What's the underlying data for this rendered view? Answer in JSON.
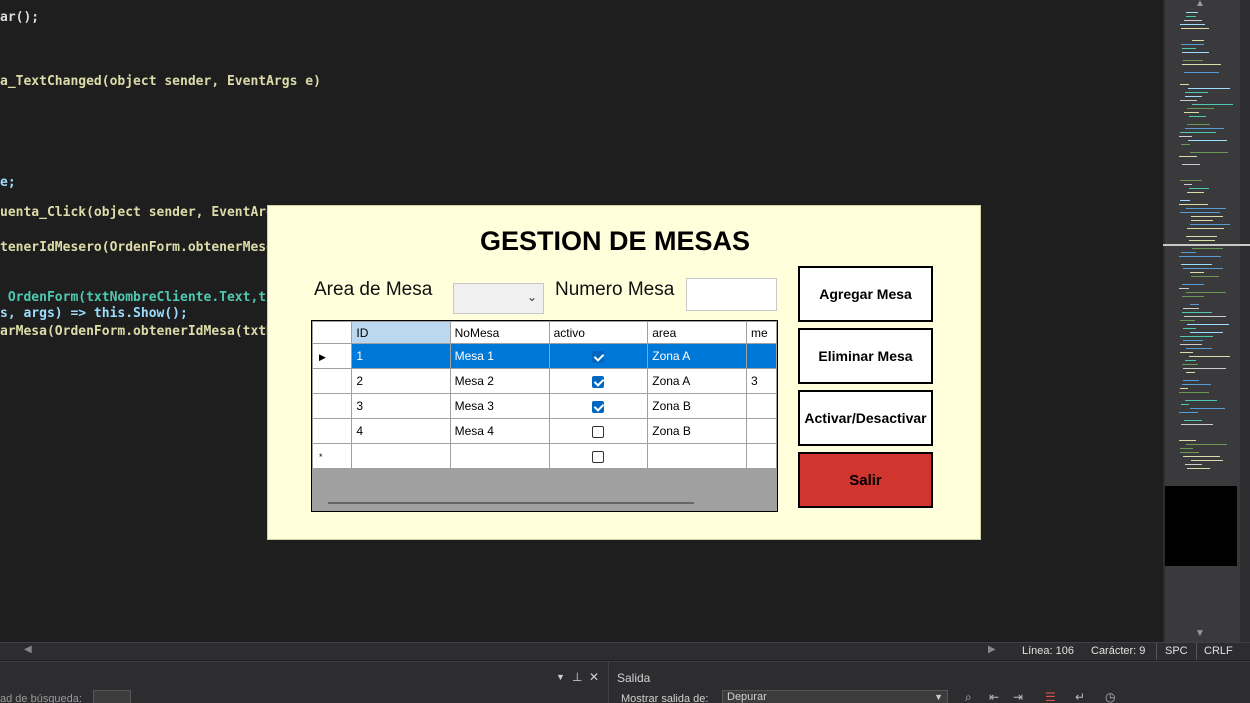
{
  "editor": {
    "lines": [
      "ar();",
      "a_TextChanged(object sender, EventArgs e)",
      "e;",
      "uenta_Click(object sender, EventArgs",
      "tenerIdMesero(OrdenForm.obtenerMesero",
      " OrdenForm(txtNombreCliente.Text,txt",
      "s, args) => this.Show();",
      "arMesa(OrdenForm.obtenerIdMesa(txtNo"
    ]
  },
  "dialog": {
    "title": "GESTION DE MESAS",
    "area_label": "Area de Mesa",
    "numero_label": "Numero Mesa",
    "area_value": "",
    "numero_value": "",
    "buttons": {
      "agregar": "Agregar Mesa",
      "eliminar": "Eliminar Mesa",
      "activar": "Activar/Desactivar",
      "salir": "Salir"
    },
    "grid": {
      "columns": [
        "ID",
        "NoMesa",
        "activo",
        "area",
        "me"
      ],
      "rows": [
        {
          "id": "1",
          "nomesa": "Mesa 1",
          "activo": true,
          "area": "Zona A",
          "extra": ""
        },
        {
          "id": "2",
          "nomesa": "Mesa 2",
          "activo": true,
          "area": "Zona A",
          "extra": "3"
        },
        {
          "id": "3",
          "nomesa": "Mesa 3",
          "activo": true,
          "area": "Zona B",
          "extra": ""
        },
        {
          "id": "4",
          "nomesa": "Mesa 4",
          "activo": false,
          "area": "Zona B",
          "extra": ""
        }
      ],
      "new_row_marker": "*",
      "current_row_marker": "▶"
    }
  },
  "statusbar": {
    "linea": "Línea: 106",
    "caracter": "Carácter: 9",
    "spc": "SPC",
    "crlf": "CRLF"
  },
  "bottom": {
    "busqueda": "ad de búsqueda:",
    "salida_title": "Salida",
    "mostrar_label": "Mostrar salida de:",
    "mostrar_value": "Depurar"
  },
  "colors": {
    "dialog_bg": "#ffffdc",
    "selected_row": "#0078d7",
    "salir_bg": "#d0352e"
  }
}
